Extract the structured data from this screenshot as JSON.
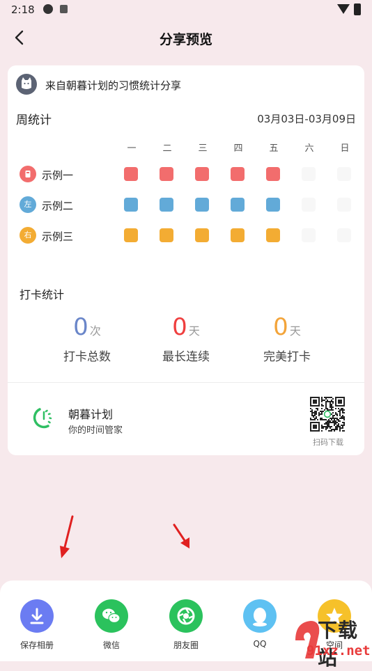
{
  "status_bar": {
    "time": "2:18"
  },
  "header": {
    "title": "分享预览"
  },
  "card": {
    "source": "来自朝暮计划的习惯统计分享",
    "week": {
      "title": "周统计",
      "range": "03月03日-03月09日",
      "days": [
        "一",
        "二",
        "三",
        "四",
        "五",
        "六",
        "日"
      ]
    },
    "habits": [
      {
        "name": "示例一",
        "icon_char": "",
        "color": "#f26d6d",
        "done": [
          1,
          1,
          1,
          1,
          1,
          0,
          0
        ]
      },
      {
        "name": "示例二",
        "icon_char": "左",
        "color": "#62aad8",
        "done": [
          1,
          1,
          1,
          1,
          1,
          0,
          0
        ]
      },
      {
        "name": "示例三",
        "icon_char": "右",
        "color": "#f3ac33",
        "done": [
          1,
          1,
          1,
          1,
          1,
          0,
          0
        ]
      }
    ],
    "checkin": {
      "title": "打卡统计",
      "stats": [
        {
          "value": "0",
          "unit": "次",
          "label": "打卡总数",
          "color": "#6a86c9"
        },
        {
          "value": "0",
          "unit": "天",
          "label": "最长连续",
          "color": "#ef3f3f"
        },
        {
          "value": "0",
          "unit": "天",
          "label": "完美打卡",
          "color": "#f3a43a"
        }
      ]
    },
    "app": {
      "name": "朝暮计划",
      "slogan": "你的时间管家",
      "qr_caption": "扫码下载"
    }
  },
  "share_sheet": {
    "items": [
      {
        "label": "保存相册",
        "color": "#6b7cf2",
        "icon": "download-icon"
      },
      {
        "label": "微信",
        "color": "#2bc25d",
        "icon": "wechat-icon"
      },
      {
        "label": "朋友圈",
        "color": "#2bc25d",
        "icon": "moments-icon"
      },
      {
        "label": "QQ",
        "color": "#5ec1f2",
        "icon": "qq-icon"
      },
      {
        "label": "空间",
        "color": "#f6c12a",
        "icon": "qzone-icon"
      }
    ]
  },
  "watermark": {
    "title": "下载站",
    "domain": "91xz.net"
  }
}
